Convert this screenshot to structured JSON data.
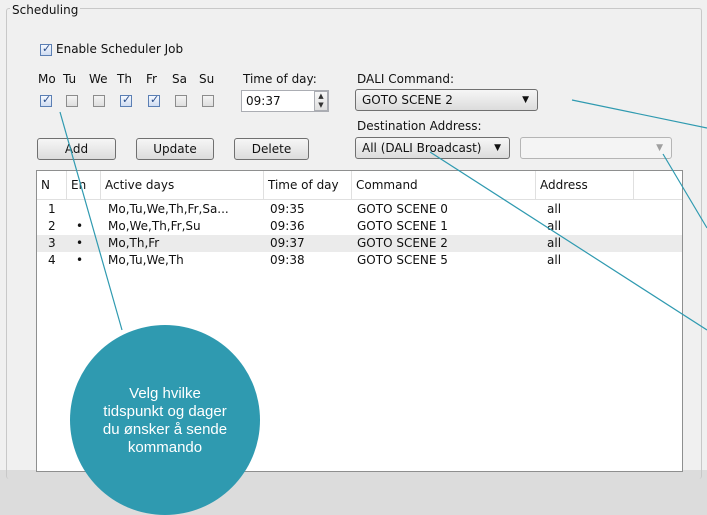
{
  "scheduling": {
    "title": "Scheduling",
    "enable_label": "Enable Scheduler Job",
    "enable_checked": true,
    "days": [
      {
        "label": "Mo",
        "checked": true
      },
      {
        "label": "Tu",
        "checked": false
      },
      {
        "label": "We",
        "checked": false
      },
      {
        "label": "Th",
        "checked": true
      },
      {
        "label": "Fr",
        "checked": true
      },
      {
        "label": "Sa",
        "checked": false
      },
      {
        "label": "Su",
        "checked": false
      }
    ],
    "time_label": "Time of day:",
    "time_value": "09:37",
    "dali_label": "DALI Command:",
    "dali_value": "GOTO SCENE 2",
    "dest_label": "Destination Address:",
    "dest_value": "All (DALI Broadcast)",
    "dest_extra_value": "",
    "buttons": {
      "add": "Add",
      "update": "Update",
      "delete": "Delete"
    }
  },
  "table": {
    "headers": [
      "N",
      "En",
      "Active days",
      "Time of day",
      "Command",
      "Address"
    ],
    "rows": [
      {
        "n": "1",
        "en": "",
        "days": "Mo,Tu,We,Th,Fr,Sa...",
        "time": "09:35",
        "command": "GOTO SCENE 0",
        "address": "all"
      },
      {
        "n": "2",
        "en": "•",
        "days": "Mo,We,Th,Fr,Su",
        "time": "09:36",
        "command": "GOTO SCENE 1",
        "address": "all"
      },
      {
        "n": "3",
        "en": "•",
        "days": "Mo,Th,Fr",
        "time": "09:37",
        "command": "GOTO SCENE 2",
        "address": "all"
      },
      {
        "n": "4",
        "en": "•",
        "days": "Mo,Tu,We,Th",
        "time": "09:38",
        "command": "GOTO SCENE 5",
        "address": "all"
      }
    ]
  },
  "callout": {
    "text": "Velg hvilke tidspunkt og dager du ønsker å sende kommando",
    "color": "#2f9ab0"
  }
}
